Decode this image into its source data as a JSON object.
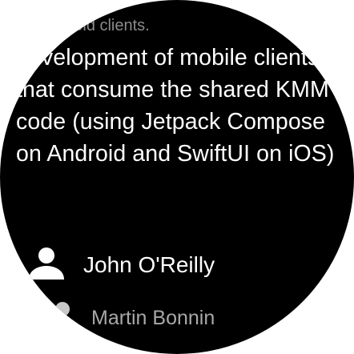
{
  "session": {
    "previous_text": "...etween iOS\nAndroid clients.",
    "abstract": "development of mobile clients that consume the shared KMM code (using Jetpack Compose on Android and SwiftUI on iOS)",
    "speakers": [
      {
        "name": "John O'Reilly",
        "icon": "person-icon"
      },
      {
        "name": "Martin Bonnin",
        "icon": "person-icon"
      }
    ]
  },
  "colors": {
    "background": "#000000",
    "text_primary": "#ffffff",
    "text_secondary": "#a8a8a8",
    "text_faded": "#8c8c8c"
  }
}
